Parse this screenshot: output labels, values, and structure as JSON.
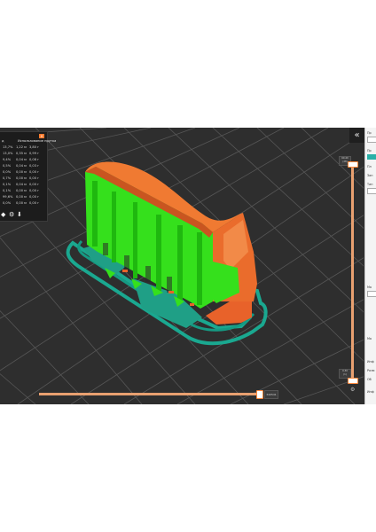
{
  "app": {
    "collapse_glyph": "«",
    "legend_close_glyph": "×",
    "colors": {
      "background": "#2e2e2e",
      "accent": "#ff7a2e",
      "support_green": "#35e01c",
      "wall_orange": "#e8622a",
      "skirt_teal": "#1aa890",
      "grid": "#555555"
    }
  },
  "legend": {
    "header_left": "д",
    "header_right": "Использование прутка",
    "rows": [
      {
        "pct": "13,7%",
        "len": "1,22 м",
        "weight": "3,80 г"
      },
      {
        "pct": "13,0%",
        "len": "0,35 м",
        "weight": "0,99 г"
      },
      {
        "pct": "9,4%",
        "len": "0,04 м",
        "weight": "0,08 г"
      },
      {
        "pct": "0,5%",
        "len": "0,04 м",
        "weight": "0,03 г"
      },
      {
        "pct": "0,0%",
        "len": "0,00 м",
        "weight": "0,00 г"
      },
      {
        "pct": "0,7%",
        "len": "0,00 м",
        "weight": "0,00 г"
      },
      {
        "pct": "0,1%",
        "len": "0,04 м",
        "weight": "0,00 г"
      },
      {
        "pct": "0,1%",
        "len": "0,00 м",
        "weight": "0,00 г"
      },
      {
        "pct": "99,6%",
        "len": "0,00 м",
        "weight": "0,00 г"
      },
      {
        "pct": "0,0%",
        "len": "0,00 м",
        "weight": "0,00 г"
      }
    ],
    "buttons": [
      {
        "name": "layers-view-icon",
        "glyph": "◆"
      },
      {
        "name": "settings-icon",
        "glyph": "⚙"
      },
      {
        "name": "export-icon",
        "glyph": "⬇"
      }
    ]
  },
  "vertical_slider": {
    "top_value": "60,40",
    "top_layer": "(28)",
    "bottom_value": "0,30",
    "bottom_layer": "(1)",
    "cog_glyph": "⚙"
  },
  "horizontal_slider": {
    "value": "340541"
  },
  "right_panel": {
    "lines": [
      "Пр",
      "Пр",
      "Пл",
      "Зап",
      "Тип",
      "Ма",
      "Ма",
      "Инф",
      "Разм",
      "Об",
      "Инф"
    ]
  }
}
